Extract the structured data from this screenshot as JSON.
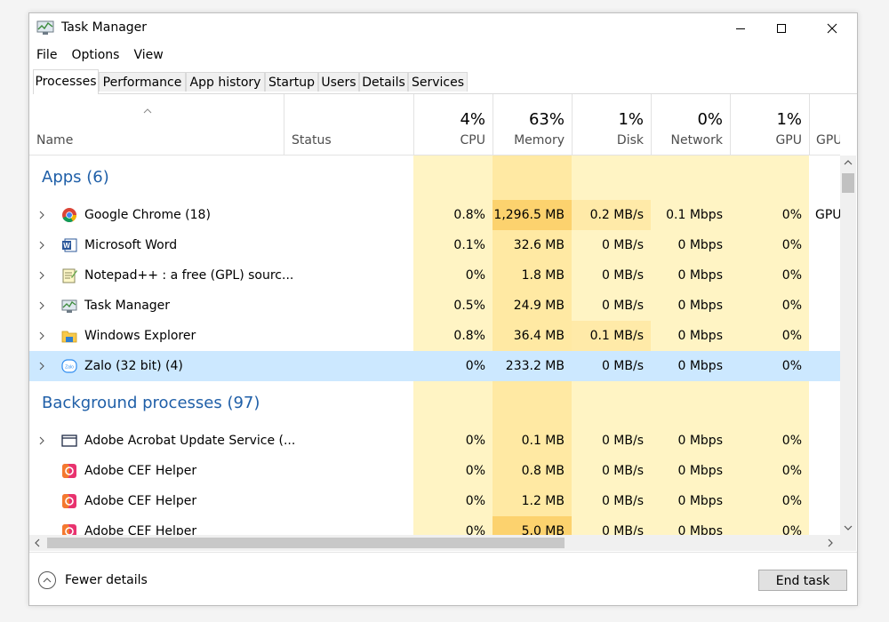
{
  "window": {
    "title": "Task Manager"
  },
  "menu": [
    "File",
    "Options",
    "View"
  ],
  "tabs": [
    "Processes",
    "Performance",
    "App history",
    "Startup",
    "Users",
    "Details",
    "Services"
  ],
  "active_tab": "Processes",
  "header": {
    "name": "Name",
    "status": "Status",
    "cpu_pct": "4%",
    "cpu": "CPU",
    "memory_pct": "63%",
    "memory": "Memory",
    "disk_pct": "1%",
    "disk": "Disk",
    "network_pct": "0%",
    "network": "Network",
    "gpu_pct": "1%",
    "gpu": "GPU",
    "gpu_engine": "GPU en"
  },
  "groups": {
    "apps": "Apps (6)",
    "background": "Background processes (97)"
  },
  "apps": [
    {
      "name": "Google Chrome (18)",
      "icon": "chrome-icon",
      "cpu": "0.8%",
      "memory": "1,296.5 MB",
      "disk": "0.2 MB/s",
      "network": "0.1 Mbps",
      "gpu": "0%",
      "gpu_engine": "GPU"
    },
    {
      "name": "Microsoft Word",
      "icon": "word-icon",
      "cpu": "0.1%",
      "memory": "32.6 MB",
      "disk": "0 MB/s",
      "network": "0 Mbps",
      "gpu": "0%",
      "gpu_engine": ""
    },
    {
      "name": "Notepad++ : a free (GPL) sourc...",
      "icon": "notepad-icon",
      "cpu": "0%",
      "memory": "1.8 MB",
      "disk": "0 MB/s",
      "network": "0 Mbps",
      "gpu": "0%",
      "gpu_engine": ""
    },
    {
      "name": "Task Manager",
      "icon": "task-manager-icon",
      "cpu": "0.5%",
      "memory": "24.9 MB",
      "disk": "0 MB/s",
      "network": "0 Mbps",
      "gpu": "0%",
      "gpu_engine": ""
    },
    {
      "name": "Windows Explorer",
      "icon": "folder-icon",
      "cpu": "0.8%",
      "memory": "36.4 MB",
      "disk": "0.1 MB/s",
      "network": "0 Mbps",
      "gpu": "0%",
      "gpu_engine": ""
    },
    {
      "name": "Zalo (32 bit) (4)",
      "icon": "zalo-icon",
      "cpu": "0%",
      "memory": "233.2 MB",
      "disk": "0 MB/s",
      "network": "0 Mbps",
      "gpu": "0%",
      "gpu_engine": ""
    }
  ],
  "background": [
    {
      "name": "Adobe Acrobat Update Service (...",
      "icon": "service-window-icon",
      "cpu": "0%",
      "memory": "0.1 MB",
      "disk": "0 MB/s",
      "network": "0 Mbps",
      "gpu": "0%"
    },
    {
      "name": "Adobe CEF Helper",
      "icon": "adobe-cc-icon",
      "cpu": "0%",
      "memory": "0.8 MB",
      "disk": "0 MB/s",
      "network": "0 Mbps",
      "gpu": "0%"
    },
    {
      "name": "Adobe CEF Helper",
      "icon": "adobe-cc-icon",
      "cpu": "0%",
      "memory": "1.2 MB",
      "disk": "0 MB/s",
      "network": "0 Mbps",
      "gpu": "0%"
    },
    {
      "name": "Adobe CEF Helper",
      "icon": "adobe-cc-icon",
      "cpu": "0%",
      "memory": "5.0 MB",
      "disk": "0 MB/s",
      "network": "0 Mbps",
      "gpu": "0%"
    }
  ],
  "footer": {
    "fewer_details": "Fewer details",
    "end_task": "End task"
  },
  "colors": {
    "heat_light": "#fff4c4",
    "heat_mid": "#ffe89f",
    "heat_high": "#fcd26e",
    "selected": "#cce8ff",
    "group_title": "#1f5fa8"
  }
}
